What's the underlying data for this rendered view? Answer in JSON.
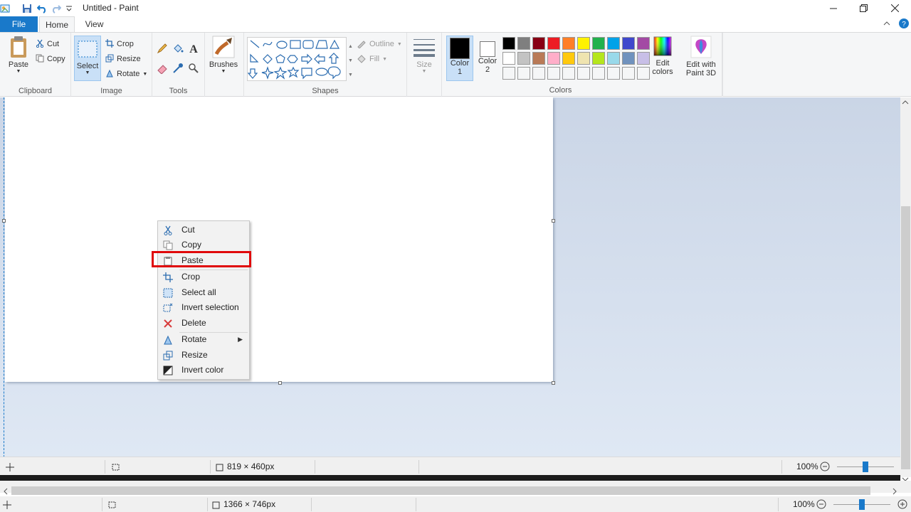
{
  "window": {
    "title": "Untitled - Paint",
    "minimize_icon": "minimize-icon",
    "maximize_icon": "restore-icon",
    "close_icon": "close-icon"
  },
  "tabs": [
    {
      "label": "File"
    },
    {
      "label": "Home"
    },
    {
      "label": "View"
    }
  ],
  "ribbon": {
    "clipboard": {
      "label": "Clipboard",
      "paste": "Paste",
      "cut": "Cut",
      "copy": "Copy"
    },
    "image": {
      "label": "Image",
      "select": "Select",
      "crop": "Crop",
      "resize": "Resize",
      "rotate": "Rotate"
    },
    "tools": {
      "label": "Tools"
    },
    "brushes": {
      "label": "Brushes"
    },
    "shapes": {
      "label": "Shapes",
      "outline": "Outline",
      "fill": "Fill"
    },
    "size": {
      "label": "Size"
    },
    "colors": {
      "label": "Colors",
      "color1": "Color 1",
      "color1_a": "Color",
      "color1_b": "1",
      "color2_a": "Color",
      "color2_b": "2",
      "edit_colors_a": "Edit",
      "edit_colors_b": "colors",
      "paint3d_a": "Edit with",
      "paint3d_b": "Paint 3D",
      "palette_row1": [
        "#000000",
        "#7f7f7f",
        "#880015",
        "#ed1c24",
        "#ff7f27",
        "#fff200",
        "#22b14c",
        "#00a2e8",
        "#3f48cc",
        "#a349a4"
      ],
      "palette_row2": [
        "#ffffff",
        "#c3c3c3",
        "#b97a57",
        "#ffaec9",
        "#ffc90e",
        "#efe4b0",
        "#b5e61d",
        "#99d9ea",
        "#7092be",
        "#c8bfe7"
      ]
    }
  },
  "context_menu": {
    "items": [
      {
        "label": "Cut",
        "icon": "scissors-icon"
      },
      {
        "label": "Copy",
        "icon": "copy-icon"
      },
      {
        "label": "Paste",
        "icon": "paste-icon"
      },
      {
        "label": "Crop",
        "icon": "crop-icon"
      },
      {
        "label": "Select all",
        "icon": "select-all-icon"
      },
      {
        "label": "Invert selection",
        "icon": "invert-selection-icon"
      },
      {
        "label": "Delete",
        "icon": "delete-icon"
      },
      {
        "label": "Rotate",
        "icon": "rotate-icon"
      },
      {
        "label": "Resize",
        "icon": "resize-icon"
      },
      {
        "label": "Invert color",
        "icon": "invert-color-icon"
      }
    ]
  },
  "status_inner": {
    "dimensions": "819 × 460px",
    "zoom": "100%"
  },
  "status_outer": {
    "dimensions": "1366 × 746px",
    "zoom": "100%"
  },
  "colors": {
    "accent": "#1979ca",
    "highlight": "#e0080a"
  }
}
